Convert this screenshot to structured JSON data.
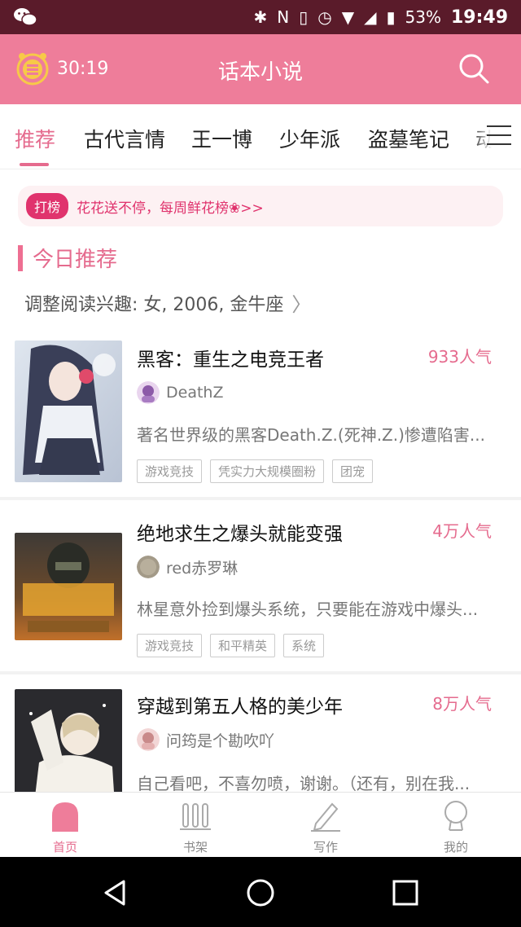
{
  "status_bar": {
    "battery": "53%",
    "time": "19:49"
  },
  "app_bar": {
    "timer": "30:19",
    "title": "话本小说"
  },
  "tabs": [
    {
      "label": "推荐"
    },
    {
      "label": "古代言情"
    },
    {
      "label": "王一博"
    },
    {
      "label": "少年派"
    },
    {
      "label": "盗墓笔记"
    },
    {
      "label": "动"
    }
  ],
  "banner": {
    "badge": "打榜",
    "text": "花花送不停，每周鲜花榜❀>>"
  },
  "section": {
    "title": "今日推荐",
    "prefs": "调整阅读兴趣: 女, 2006, 金牛座"
  },
  "books": [
    {
      "title": "黑客：重生之电竞王者",
      "popularity": "933人气",
      "author": "DeathZ",
      "desc": "著名世界级的黑客Death.Z.(死神.Z.)惨遭陷害...",
      "tags": [
        "游戏竞技",
        "凭实力大规模圈粉",
        "团宠"
      ]
    },
    {
      "title": "绝地求生之爆头就能变强",
      "popularity": "4万人气",
      "author": "red赤罗琳",
      "desc": "林星意外捡到爆头系统，只要能在游戏中爆头...",
      "tags": [
        "游戏竞技",
        "和平精英",
        "系统"
      ]
    },
    {
      "title": "穿越到第五人格的美少年",
      "popularity": "8万人气",
      "author": "问筠是个勘吹吖",
      "desc": "自己看吧，不喜勿喷，谢谢。（还有，别在我...",
      "tags": []
    }
  ],
  "bottom_nav": [
    {
      "label": "首页",
      "icon": "home-icon"
    },
    {
      "label": "书架",
      "icon": "bookshelf-icon"
    },
    {
      "label": "写作",
      "icon": "pen-icon"
    },
    {
      "label": "我的",
      "icon": "profile-icon"
    }
  ],
  "colors": {
    "accent": "#e56b8e",
    "header": "#ee7d9a",
    "statusbar": "#5a1b2a"
  }
}
